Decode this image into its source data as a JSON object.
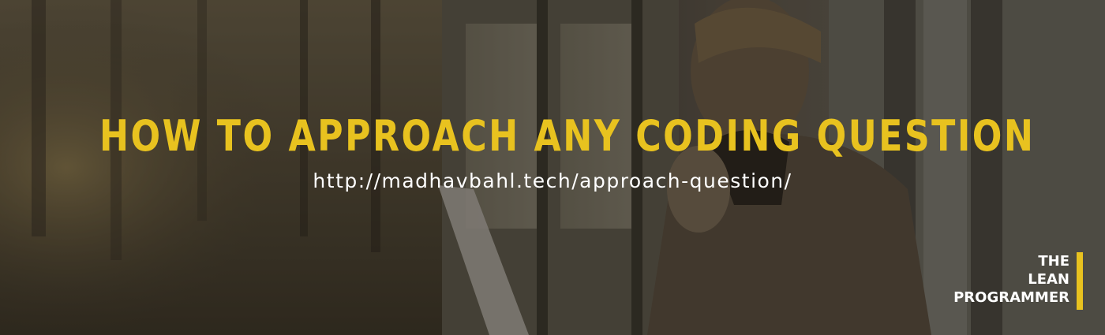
{
  "banner": {
    "title": "HOW TO APPROACH ANY CODING QUESTION",
    "url": "http://madhavbahl.tech/approach-question/",
    "brand": {
      "line1": "THE",
      "line2": "LEAN",
      "line3": "PROGRAMMER"
    },
    "colors": {
      "accent": "#e8c21f",
      "text": "#ffffff"
    },
    "background_image": "photo of man with laptop near window"
  }
}
